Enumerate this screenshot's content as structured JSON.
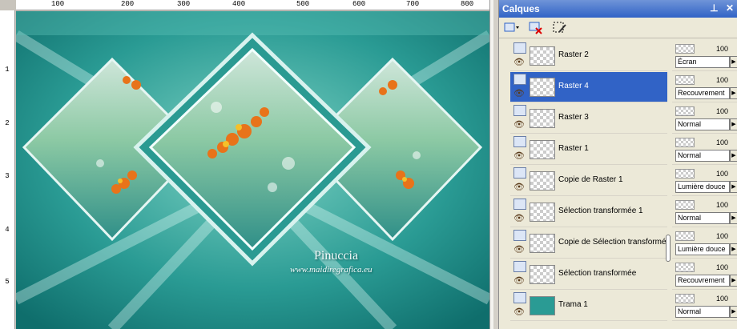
{
  "ruler_top": [
    "100",
    "200",
    "300",
    "400",
    "500",
    "600",
    "700",
    "800"
  ],
  "ruler_left": [
    "1",
    "2",
    "3",
    "4",
    "5"
  ],
  "artwork": {
    "watermark_title": "Pinuccia",
    "watermark_url": "www.maidiregrafica.eu"
  },
  "panel": {
    "title": "Calques",
    "pin_icon": "pin-icon",
    "close_icon": "close-icon"
  },
  "toolbar": {
    "new_layer": "new-layer-icon",
    "delete_layer": "delete-layer-icon",
    "edit_selection": "edit-selection-icon"
  },
  "layers": [
    {
      "name": "Raster 2",
      "opacity": "100",
      "blend": "Écran",
      "selected": false
    },
    {
      "name": "Raster 4",
      "opacity": "100",
      "blend": "Recouvrement",
      "selected": true
    },
    {
      "name": "Raster 3",
      "opacity": "100",
      "blend": "Normal",
      "selected": false
    },
    {
      "name": "Raster 1",
      "opacity": "100",
      "blend": "Normal",
      "selected": false
    },
    {
      "name": "Copie de Raster 1",
      "opacity": "100",
      "blend": "Lumière douce",
      "selected": false
    },
    {
      "name": "Sélection transformée 1",
      "opacity": "100",
      "blend": "Normal",
      "selected": false
    },
    {
      "name": "Copie de Sélection transformée",
      "opacity": "100",
      "blend": "Lumière douce",
      "selected": false
    },
    {
      "name": "Sélection transformée",
      "opacity": "100",
      "blend": "Recouvrement",
      "selected": false
    },
    {
      "name": "Trama 1",
      "opacity": "100",
      "blend": "Normal",
      "selected": false
    }
  ],
  "colors": {
    "accent": "#3163c6",
    "teal": "#1d8a86",
    "orange": "#e8731a"
  }
}
